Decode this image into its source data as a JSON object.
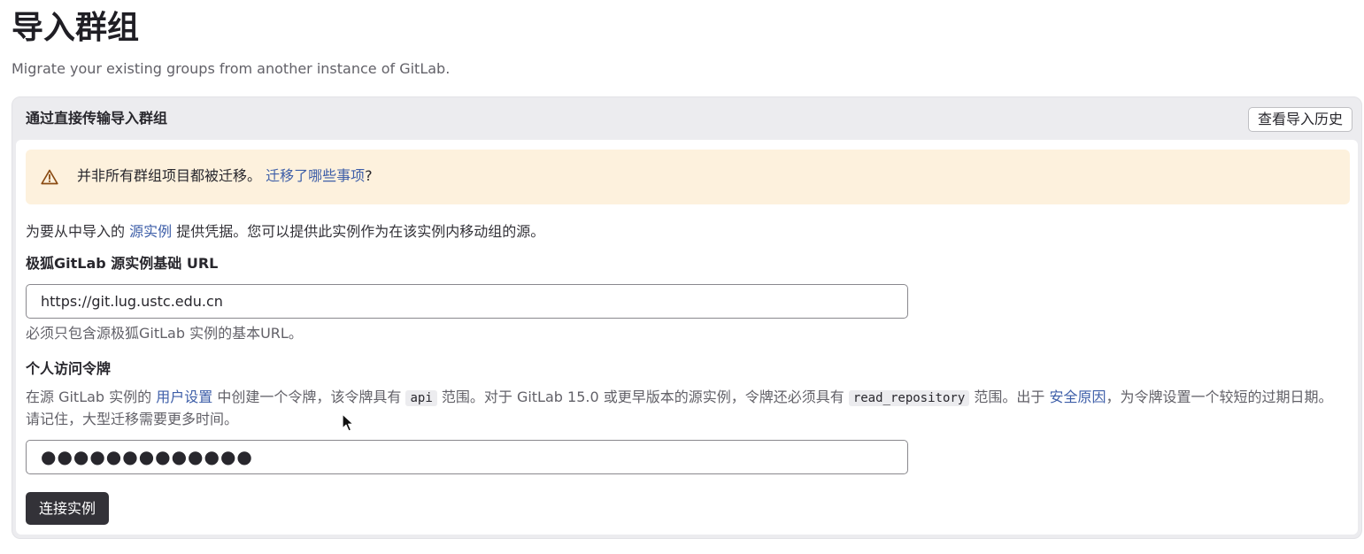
{
  "page": {
    "title": "导入群组",
    "subtitle": "Migrate your existing groups from another instance of GitLab."
  },
  "card": {
    "header_title": "通过直接传输导入群组",
    "history_button": "查看导入历史"
  },
  "alert": {
    "icon": "warning-icon",
    "text": "并非所有群组项目都被迁移。",
    "link_text": "迁移了哪些事项",
    "suffix": "?",
    "colors": {
      "background": "#fdf1dd",
      "icon": "#8a4b12"
    }
  },
  "intro": {
    "before": "为要从中导入的 ",
    "link_text": "源实例",
    "after": " 提供凭据。您可以提供此实例作为在该实例内移动组的源。"
  },
  "url_field": {
    "label": "极狐GitLab 源实例基础 URL",
    "value": "https://git.lug.ustc.edu.cn",
    "help": "必须只包含源极狐GitLab 实例的基本URL。"
  },
  "token_field": {
    "label": "个人访问令牌",
    "help_part1": "在源 GitLab 实例的 ",
    "help_link1": "用户设置",
    "help_part2": " 中创建一个令牌，该令牌具有 ",
    "help_code1": "api",
    "help_part3": " 范围。对于 GitLab 15.0 或更早版本的源实例，令牌还必须具有 ",
    "help_code2": "read_repository",
    "help_part4": " 范围。出于 ",
    "help_link2": "安全原因",
    "help_part5": "，为令牌设置一个较短的过期日期。请记住，大型迁移需要更多时间。",
    "masked_value": "●●●●●●●●●●●●●"
  },
  "connect_button": "连接实例",
  "colors": {
    "link": "#3d5ea8",
    "primary_button": "#333238",
    "card_bg": "#ececef"
  }
}
